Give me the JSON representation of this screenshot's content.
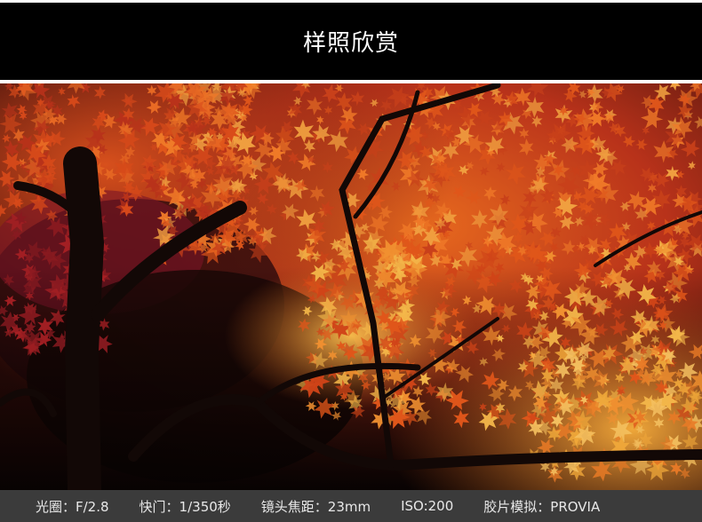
{
  "header": {
    "title": "样照欣赏"
  },
  "photo": {
    "subject": "autumn-maple-tree-photo"
  },
  "exif": {
    "aperture": "光圈：F/2.8",
    "shutter": "快门：1/350秒",
    "focal_length": "镜头焦距：23mm",
    "iso": "ISO:200",
    "film_simulation": "胶片模拟：PROVIA"
  },
  "colors": {
    "header_bg": "#000000",
    "exif_bg": "#3b3b3b",
    "leaf_orange": "#e0561a",
    "leaf_red": "#b8201c",
    "leaf_yellow": "#f0a83a"
  }
}
